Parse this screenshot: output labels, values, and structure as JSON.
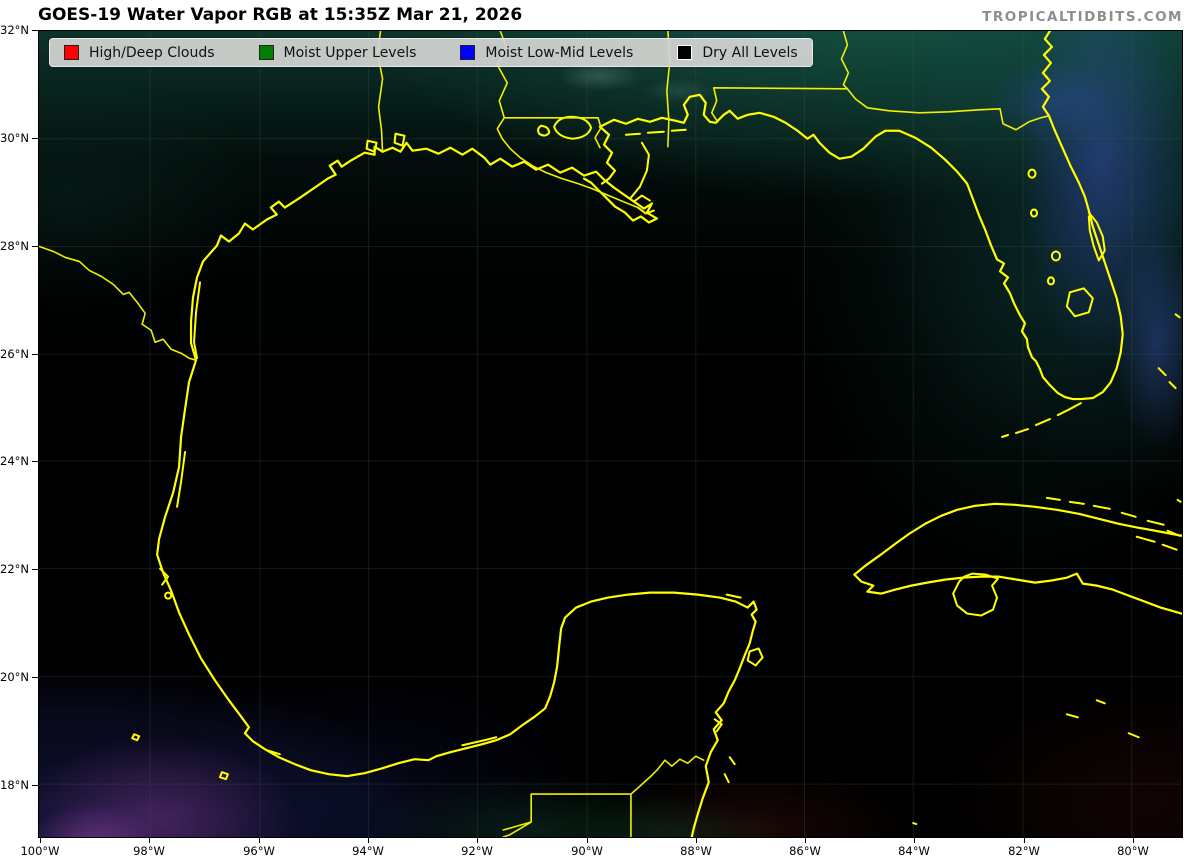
{
  "header": {
    "title": "GOES-19 Water Vapor RGB at 15:35Z Mar 21, 2026",
    "watermark": "TROPICALTIDBITS.COM"
  },
  "legend": {
    "items": [
      {
        "label": "High/Deep Clouds",
        "color": "#ff0000"
      },
      {
        "label": "Moist Upper Levels",
        "color": "#008000"
      },
      {
        "label": "Moist Low-Mid Levels",
        "color": "#0000ff"
      },
      {
        "label": "Dry All Levels",
        "color": "#000000"
      }
    ]
  },
  "axes": {
    "lat_labels": [
      "32°N",
      "30°N",
      "28°N",
      "26°N",
      "24°N",
      "22°N",
      "20°N",
      "18°N"
    ],
    "lon_labels": [
      "100°W",
      "98°W",
      "96°W",
      "94°W",
      "92°W",
      "90°W",
      "88°W",
      "86°W",
      "84°W",
      "82°W",
      "80°W"
    ]
  },
  "map": {
    "coastline_color": "#ffff00",
    "background_color": "#000000",
    "moist_upper_color": "#0d362d",
    "moist_lowmid_color": "#262c78",
    "cloud_moisture_purple": "#8e3ea0",
    "dry_tint_color": "#46120e"
  }
}
